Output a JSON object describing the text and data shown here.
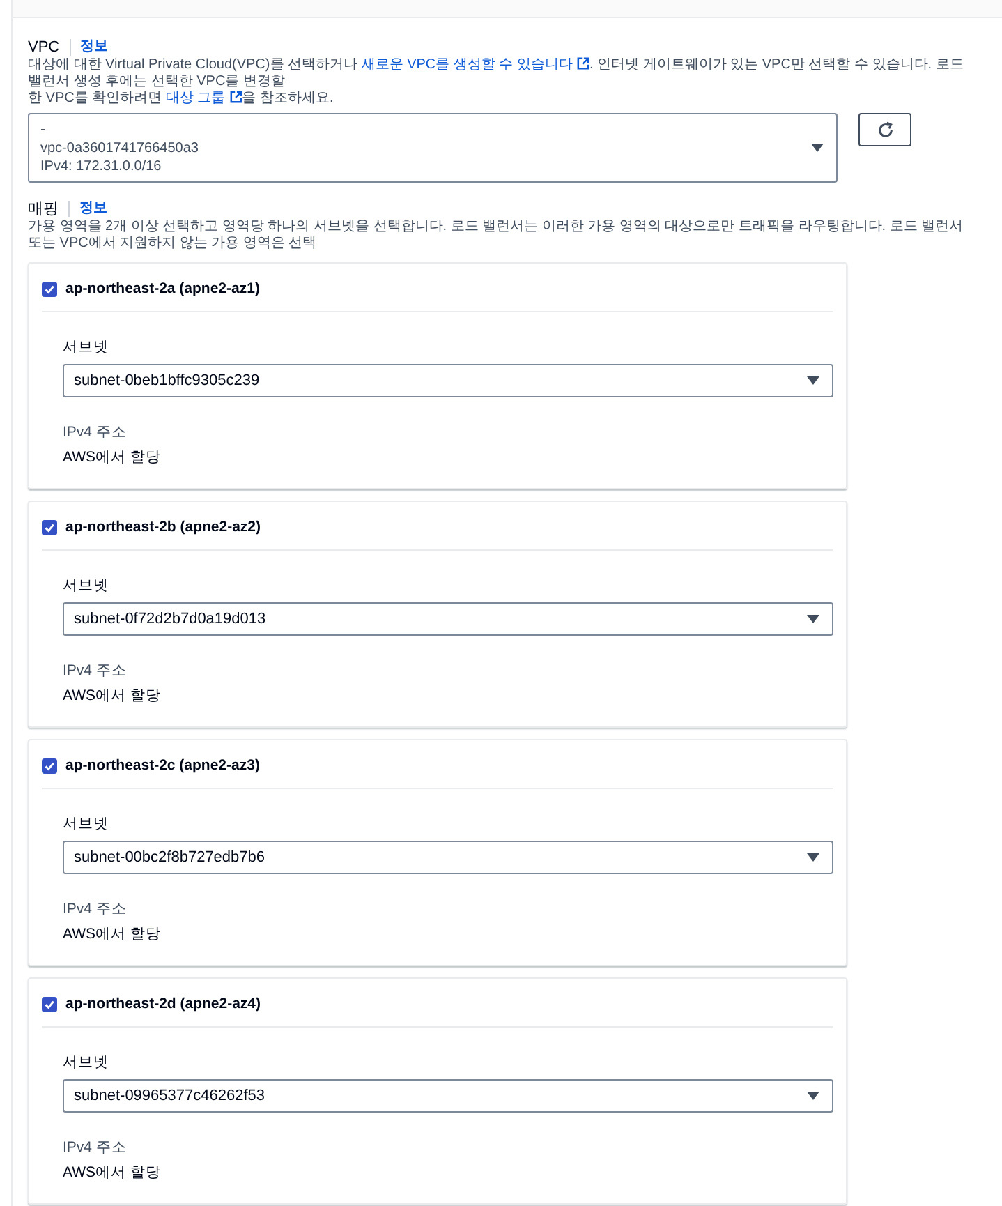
{
  "vpc": {
    "label": "VPC",
    "info_link": "정보",
    "description": [
      {
        "kind": "text",
        "text": "대상에 대한 Virtual Private Cloud(VPC)를 선택하거나 "
      },
      {
        "kind": "link",
        "text": "새로운 VPC를 생성할 수 있습니다",
        "external": true
      },
      {
        "kind": "text",
        "text": ". 인터넷 게이트웨이가 있는 VPC만 선택할 수 있습니다. 로드 밸런서 생성 후에는 선택한 VPC를 변경할"
      },
      {
        "kind": "break"
      },
      {
        "kind": "text",
        "text": "한 VPC를 확인하려면 "
      },
      {
        "kind": "link",
        "text": "대상 그룹",
        "external": true
      },
      {
        "kind": "text",
        "text": "을 참조하세요."
      }
    ],
    "select": {
      "name": "-",
      "id": "vpc-0a3601741766450a3",
      "detail": "IPv4: 172.31.0.0/16"
    }
  },
  "mapping": {
    "label": "매핑",
    "info_link": "정보",
    "description": "가용 영역을 2개 이상 선택하고 영역당 하나의 서브넷을 선택합니다. 로드 밸런서는 이러한 가용 영역의 대상으로만 트래픽을 라우팅합니다. 로드 밸런서 또는 VPC에서 지원하지 않는 가용 영역은 선택",
    "zones": [
      {
        "name": "ap-northeast-2a (apne2-az1)",
        "checked": true,
        "subnet_label": "서브넷",
        "subnet": "subnet-0beb1bffc9305c239",
        "ipv4_label": "IPv4 주소",
        "ipv4_value": "AWS에서 할당"
      },
      {
        "name": "ap-northeast-2b (apne2-az2)",
        "checked": true,
        "subnet_label": "서브넷",
        "subnet": "subnet-0f72d2b7d0a19d013",
        "ipv4_label": "IPv4 주소",
        "ipv4_value": "AWS에서 할당"
      },
      {
        "name": "ap-northeast-2c (apne2-az3)",
        "checked": true,
        "subnet_label": "서브넷",
        "subnet": "subnet-00bc2f8b727edb7b6",
        "ipv4_label": "IPv4 주소",
        "ipv4_value": "AWS에서 할당"
      },
      {
        "name": "ap-northeast-2d (apne2-az4)",
        "checked": true,
        "subnet_label": "서브넷",
        "subnet": "subnet-09965377c46262f53",
        "ipv4_label": "IPv4 주소",
        "ipv4_value": "AWS에서 할당"
      }
    ]
  }
}
